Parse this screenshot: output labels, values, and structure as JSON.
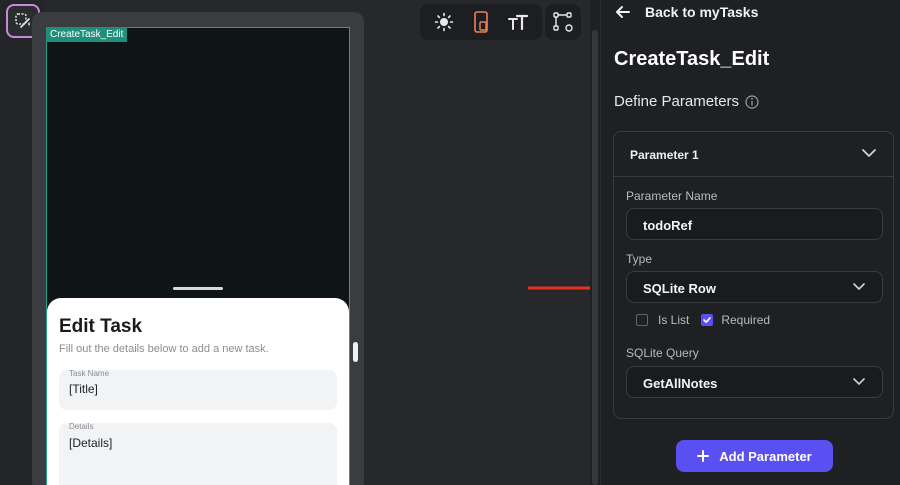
{
  "canvas": {
    "frame_tag": "CreateTask_Edit",
    "sheet": {
      "title": "Edit Task",
      "subtitle": "Fill out the details below to add a new task.",
      "fields": [
        {
          "label": "Task Name",
          "value": "[Title]"
        },
        {
          "label": "Details",
          "value": "[Details]"
        }
      ]
    }
  },
  "toolbar": {
    "icons": [
      "sun-icon",
      "device-icon",
      "text-size-icon",
      "widget-tree-icon"
    ],
    "accent": "#e8825a"
  },
  "panel": {
    "back_label": "Back to myTasks",
    "page_name": "CreateTask_Edit",
    "section_title": "Define Parameters",
    "parameter": {
      "header": "Parameter 1",
      "name_label": "Parameter Name",
      "name_value": "todoRef",
      "type_label": "Type",
      "type_value": "SQLite Row",
      "is_list_label": "Is List",
      "is_list_checked": false,
      "required_label": "Required",
      "required_checked": true,
      "query_label": "SQLite Query",
      "query_value": "GetAllNotes"
    },
    "add_button": "Add Parameter"
  },
  "colors": {
    "frame_border": "#2aa08a",
    "primary": "#5a4ff0",
    "arrow": "#e8301f"
  }
}
